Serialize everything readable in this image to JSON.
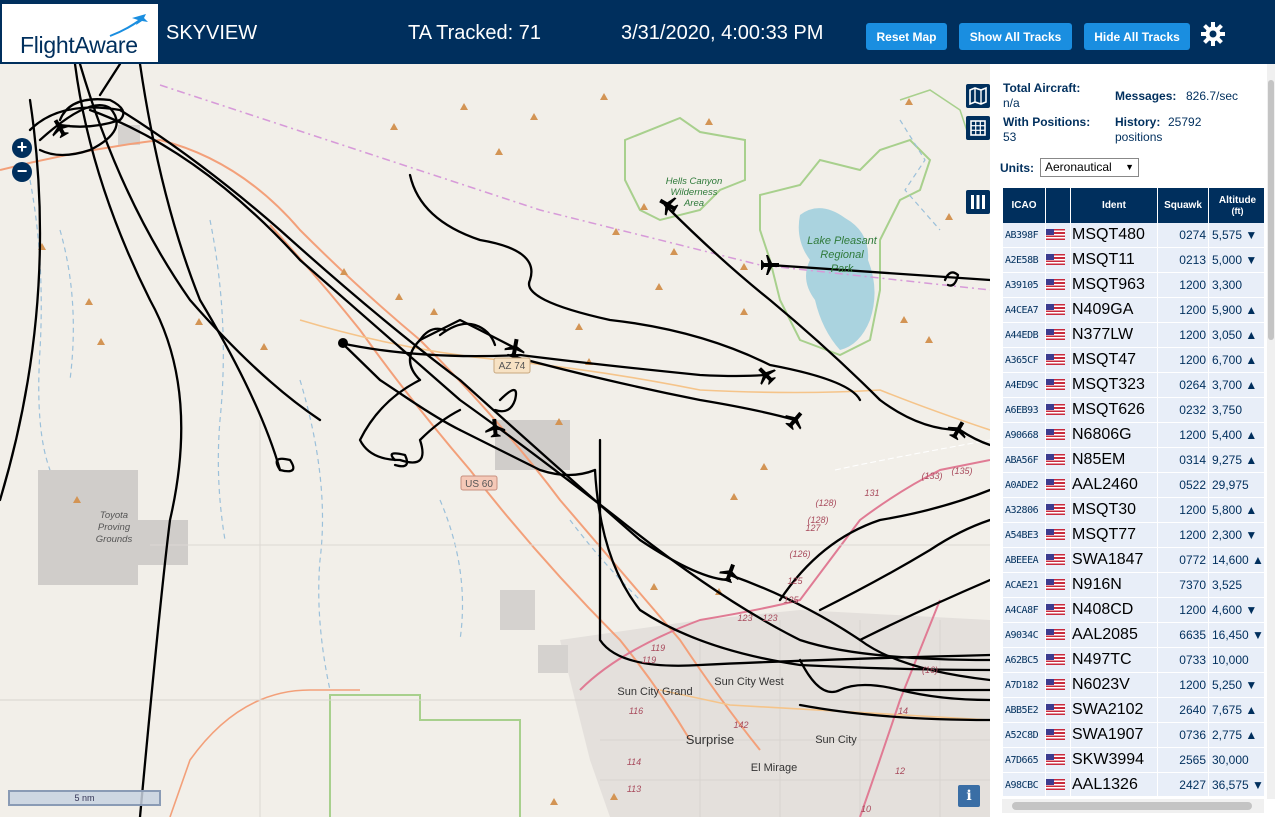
{
  "header": {
    "logo": "FlightAware",
    "brand": "SKYVIEW",
    "ta_tracked": "TA Tracked: 71",
    "datetime": "3/31/2020, 4:00:33 PM",
    "buttons": {
      "reset_map": "Reset Map",
      "show_all_tracks": "Show All Tracks",
      "hide_all_tracks": "Hide All Tracks"
    },
    "settings_icon": "gear-icon",
    "color": "#002f5d",
    "button_color": "#1a8ee0"
  },
  "map": {
    "zoom_in": "+",
    "zoom_out": "−",
    "scale": "5 nm",
    "info": "i",
    "labels": {
      "hells_canyon": "Hells Canyon",
      "wilderness": "Wilderness",
      "area": "Area",
      "lake_pleasant": "Lake Pleasant",
      "regional": "Regional",
      "park": "Park",
      "toyota": "Toyota",
      "proving": "Proving",
      "grounds": "Grounds",
      "az74": "AZ 74",
      "us60": "US 60",
      "sun_city_grand": "Sun City Grand",
      "sun_city_west": "Sun City West",
      "sun_city": "Sun City",
      "surprise": "Surprise",
      "el_mirage": "El Mirage"
    },
    "route_labels": [
      "(133)",
      "(135)",
      "131",
      "(128)",
      "(128)",
      "127",
      "(126)",
      "125",
      "125",
      "123",
      "123",
      "119",
      "119",
      "116",
      "114",
      "113",
      "142",
      "(16)",
      "14",
      "12",
      "10"
    ]
  },
  "stats": {
    "total_aircraft_label": "Total Aircraft:",
    "total_aircraft": "n/a",
    "with_positions_label": "With Positions:",
    "with_positions": "53",
    "messages_label": "Messages:",
    "messages": "826.7/sec",
    "history_label": "History:",
    "history": "25792",
    "history_unit": "positions",
    "units_label": "Units:",
    "units_value": "Aeronautical"
  },
  "table": {
    "headers": {
      "icao": "ICAO",
      "ident": "Ident",
      "squawk": "Squawk",
      "altitude": "Altitude",
      "altitude_unit": "(ft)"
    },
    "rows": [
      [
        "AB398F",
        "MSQT480",
        "0274",
        "5,575 ▼"
      ],
      [
        "A2E58B",
        "MSQT11",
        "0213",
        "5,000 ▼"
      ],
      [
        "A39105",
        "MSQT963",
        "1200",
        "3,300"
      ],
      [
        "A4CEA7",
        "N409GA",
        "1200",
        "5,900 ▲"
      ],
      [
        "A44EDB",
        "N377LW",
        "1200",
        "3,050 ▲"
      ],
      [
        "A365CF",
        "MSQT47",
        "1200",
        "6,700 ▲"
      ],
      [
        "A4ED9C",
        "MSQT323",
        "0264",
        "3,700 ▲"
      ],
      [
        "A6EB93",
        "MSQT626",
        "0232",
        "3,750"
      ],
      [
        "A90668",
        "N6806G",
        "1200",
        "5,400 ▲"
      ],
      [
        "ABA56F",
        "N85EM",
        "0314",
        "9,275 ▲"
      ],
      [
        "A0ADE2",
        "AAL2460",
        "0522",
        "29,975"
      ],
      [
        "A32806",
        "MSQT30",
        "1200",
        "5,800 ▲"
      ],
      [
        "A54BE3",
        "MSQT77",
        "1200",
        "2,300 ▼"
      ],
      [
        "ABEEEA",
        "SWA1847",
        "0772",
        "14,600 ▲"
      ],
      [
        "ACAE21",
        "N916N",
        "7370",
        "3,525"
      ],
      [
        "A4CA8F",
        "N408CD",
        "1200",
        "4,600 ▼"
      ],
      [
        "A9034C",
        "AAL2085",
        "6635",
        "16,450 ▼"
      ],
      [
        "A62BC5",
        "N497TC",
        "0733",
        "10,000"
      ],
      [
        "A7D182",
        "N6023V",
        "1200",
        "5,250 ▼"
      ],
      [
        "ABB5E2",
        "SWA2102",
        "2640",
        "7,675 ▲"
      ],
      [
        "A52C8D",
        "SWA1907",
        "0736",
        "2,775 ▲"
      ],
      [
        "A7D665",
        "SKW3994",
        "2565",
        "30,000"
      ],
      [
        "A98CBC",
        "AAL1326",
        "2427",
        "36,575 ▼"
      ]
    ]
  }
}
